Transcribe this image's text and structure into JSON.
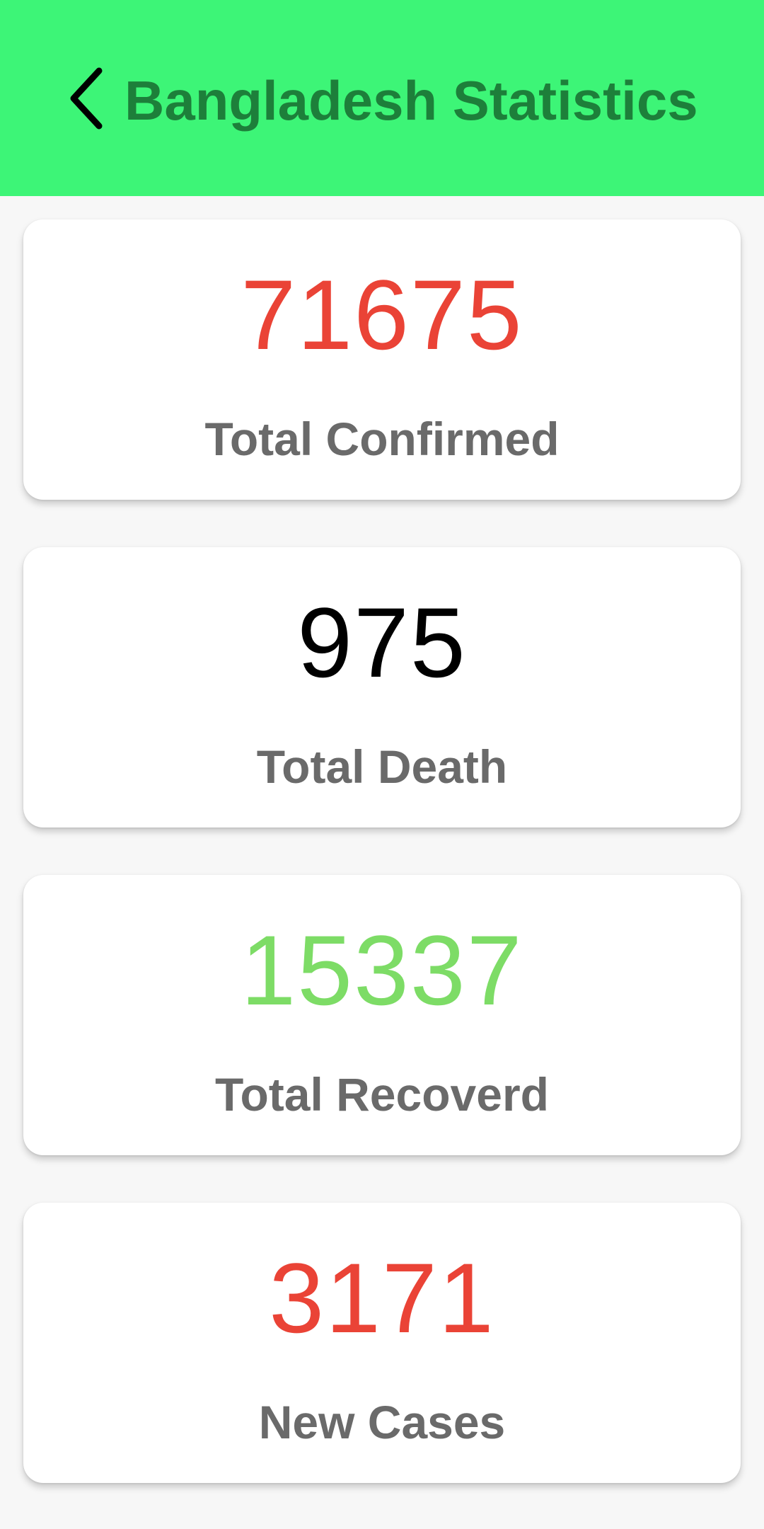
{
  "header": {
    "title": "Bangladesh Statistics",
    "back_icon": "chevron-left-icon",
    "background_color": "#3df577",
    "title_color": "#1d7f3a"
  },
  "stats": [
    {
      "value": "71675",
      "label": "Total Confirmed",
      "value_color": "#ea4336"
    },
    {
      "value": "975",
      "label": "Total Death",
      "value_color": "#000000"
    },
    {
      "value": "15337",
      "label": "Total Recoverd",
      "value_color": "#7ddc66"
    },
    {
      "value": "3171",
      "label": "New Cases",
      "value_color": "#ea4336"
    }
  ]
}
